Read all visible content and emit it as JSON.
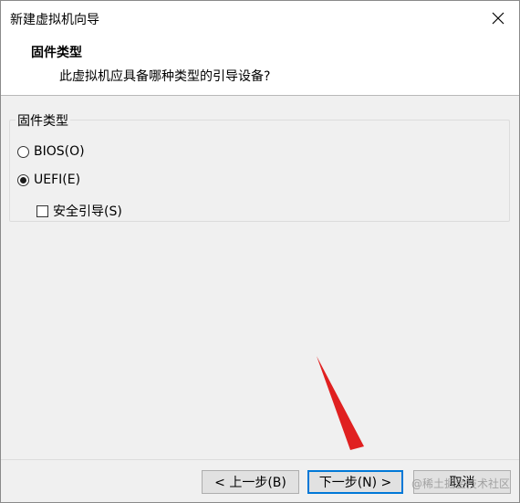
{
  "window": {
    "title": "新建虚拟机向导"
  },
  "header": {
    "title": "固件类型",
    "subtitle": "此虚拟机应具备哪种类型的引导设备?"
  },
  "group": {
    "legend": "固件类型",
    "options": [
      {
        "label": "BIOS(O)",
        "checked": false
      },
      {
        "label": "UEFI(E)",
        "checked": true
      }
    ],
    "secure_boot": {
      "label": "安全引导(S)",
      "checked": false
    }
  },
  "buttons": {
    "back": "< 上一步(B)",
    "next": "下一步(N) >",
    "cancel": "取消"
  },
  "watermark": "@稀土掘金技术社区",
  "colors": {
    "accent": "#0078d7",
    "annotation_arrow": "#e02020"
  },
  "icons": {
    "close": "close-icon"
  }
}
